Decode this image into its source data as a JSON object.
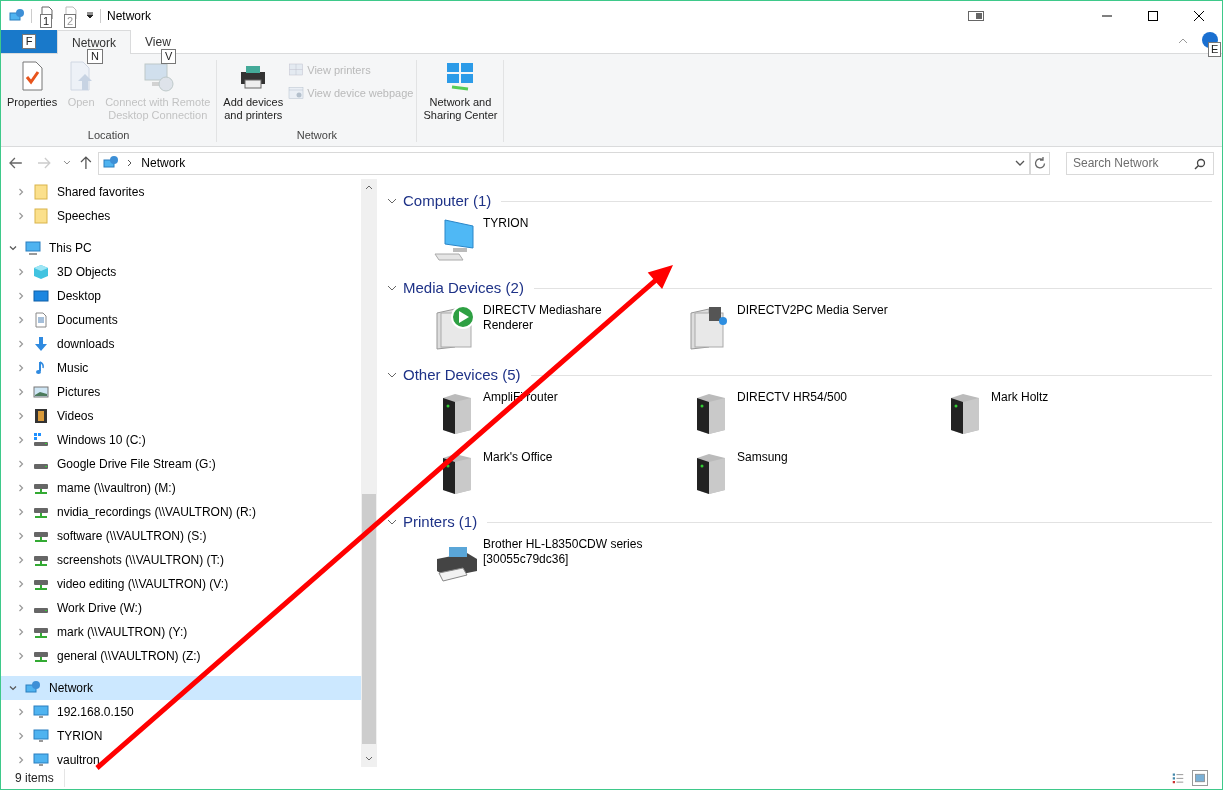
{
  "window": {
    "title": "Network",
    "quick_keytips": [
      "1",
      "2"
    ]
  },
  "file_tab": {
    "keytip": "F"
  },
  "tabs": [
    {
      "label": "Network",
      "selected": true,
      "keytip": "N"
    },
    {
      "label": "View",
      "selected": false,
      "keytip": "V"
    }
  ],
  "help_keytip": "E",
  "ribbon": [
    {
      "label": "Location",
      "buttons": [
        {
          "kind": "properties",
          "label": "Properties",
          "disabled": false
        },
        {
          "kind": "open",
          "label": "Open",
          "disabled": true
        },
        {
          "kind": "remote",
          "label": "Connect with Remote\nDesktop Connection",
          "disabled": true
        }
      ]
    },
    {
      "label": "Network",
      "buttons": [
        {
          "kind": "add-printer",
          "label": "Add devices\nand printers",
          "disabled": false
        }
      ],
      "small_buttons": [
        {
          "kind": "printers",
          "label": "View printers",
          "disabled": true
        },
        {
          "kind": "webpage",
          "label": "View device webpage",
          "disabled": true
        }
      ]
    },
    {
      "buttons": [
        {
          "kind": "sharing",
          "label": "Network and\nSharing Center",
          "disabled": false
        }
      ]
    }
  ],
  "address": {
    "path": "Network"
  },
  "search": {
    "placeholder": "Search Network"
  },
  "quick_access": [
    {
      "label": "Shared favorites",
      "kind": "folder",
      "expanded": false,
      "selected": false
    },
    {
      "label": "Speeches",
      "kind": "folder",
      "expanded": false,
      "selected": false
    }
  ],
  "nav": [
    {
      "label": "This PC",
      "kind": "pc",
      "expanded": true,
      "selected": false,
      "children": [
        {
          "label": "3D Objects",
          "kind": "cube",
          "expanded": false,
          "selected": false
        },
        {
          "label": "Desktop",
          "kind": "desktop",
          "expanded": false,
          "selected": false
        },
        {
          "label": "Documents",
          "kind": "doc",
          "expanded": false,
          "selected": false
        },
        {
          "label": "downloads",
          "kind": "down",
          "expanded": false,
          "selected": false
        },
        {
          "label": "Music",
          "kind": "music",
          "expanded": false,
          "selected": false
        },
        {
          "label": "Pictures",
          "kind": "picture",
          "expanded": false,
          "selected": false
        },
        {
          "label": "Videos",
          "kind": "video",
          "expanded": false,
          "selected": false
        },
        {
          "label": "Windows 10 (C:)",
          "kind": "sysdrive",
          "expanded": false,
          "selected": false
        },
        {
          "label": "Google Drive File Stream (G:)",
          "kind": "drive",
          "expanded": false,
          "selected": false
        },
        {
          "label": "mame (\\\\vaultron) (M:)",
          "kind": "netdrive",
          "expanded": false,
          "selected": false
        },
        {
          "label": "nvidia_recordings (\\\\VAULTRON) (R:)",
          "kind": "netdrive",
          "expanded": false,
          "selected": false
        },
        {
          "label": "software (\\\\VAULTRON) (S:)",
          "kind": "netdrive",
          "expanded": false,
          "selected": false
        },
        {
          "label": "screenshots (\\\\VAULTRON) (T:)",
          "kind": "netdrive",
          "expanded": false,
          "selected": false
        },
        {
          "label": "video editing (\\\\VAULTRON) (V:)",
          "kind": "netdrive",
          "expanded": false,
          "selected": false
        },
        {
          "label": "Work Drive (W:)",
          "kind": "drive",
          "expanded": false,
          "selected": false
        },
        {
          "label": "mark (\\\\VAULTRON) (Y:)",
          "kind": "netdrive",
          "expanded": false,
          "selected": false
        },
        {
          "label": "general (\\\\VAULTRON) (Z:)",
          "kind": "netdrive",
          "expanded": false,
          "selected": false
        }
      ]
    },
    {
      "label": "Network",
      "kind": "network",
      "expanded": true,
      "selected": true,
      "children": [
        {
          "label": "192.168.0.150",
          "kind": "monitor",
          "expanded": false,
          "selected": false
        },
        {
          "label": "TYRION",
          "kind": "monitor",
          "expanded": false,
          "selected": false
        },
        {
          "label": "vaultron",
          "kind": "monitor",
          "expanded": false,
          "selected": false
        }
      ]
    }
  ],
  "groups": [
    {
      "title": "Computer (1)",
      "expanded": true,
      "items": [
        {
          "label": "TYRION",
          "kind": "computer"
        }
      ]
    },
    {
      "title": "Media Devices (2)",
      "expanded": true,
      "items": [
        {
          "label": "DIRECTV Mediashare\nRenderer",
          "kind": "renderer"
        },
        {
          "label": "DIRECTV2PC Media Server",
          "kind": "mediaserver"
        }
      ]
    },
    {
      "title": "Other Devices (5)",
      "expanded": true,
      "items": [
        {
          "label": "AmpliFi router",
          "kind": "device"
        },
        {
          "label": "DIRECTV HR54/500",
          "kind": "device"
        },
        {
          "label": "Mark Holtz",
          "kind": "device"
        },
        {
          "label": "Mark's Office",
          "kind": "device"
        },
        {
          "label": "Samsung",
          "kind": "device"
        }
      ]
    },
    {
      "title": "Printers (1)",
      "expanded": true,
      "items": [
        {
          "label": "Brother HL-L8350CDW series\n[30055c79dc36]",
          "kind": "printer"
        }
      ]
    }
  ],
  "status_bar": {
    "count": "9 items"
  },
  "views": [
    {
      "kind": "details",
      "selected": false
    },
    {
      "kind": "large-icons",
      "selected": true
    }
  ]
}
